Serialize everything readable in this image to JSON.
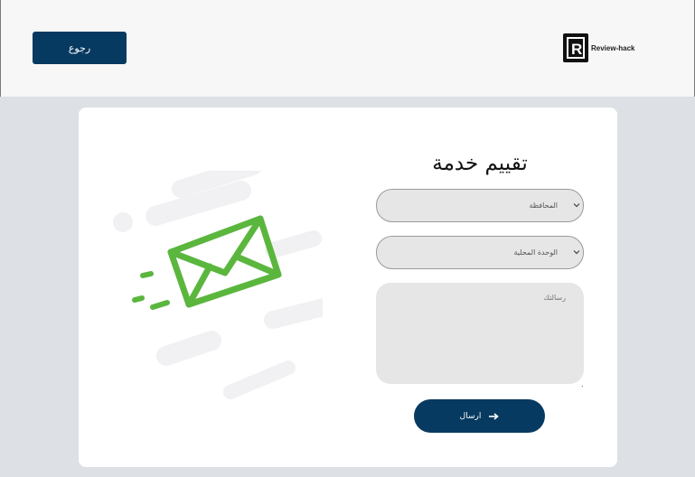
{
  "header": {
    "back_label": "رجوع",
    "logo_text": "Review-hack",
    "logo_letter": "R"
  },
  "form": {
    "title": "تقييم خدمة",
    "governorate_select": {
      "selected": "المحافظة"
    },
    "local_unit_select": {
      "selected": "الوحدة المحلية"
    },
    "message": {
      "placeholder": "رسالتك"
    },
    "trailing_dot": ".",
    "submit_label": "ارسال"
  },
  "icons": [
    "arrow-right-icon",
    "chevron-down-icon",
    "envelope-icon"
  ],
  "colors": {
    "primary": "#073a60",
    "envelope_green": "#5bb63e",
    "page_bg": "#dde0e5",
    "field_bg": "#e6e6e6"
  }
}
